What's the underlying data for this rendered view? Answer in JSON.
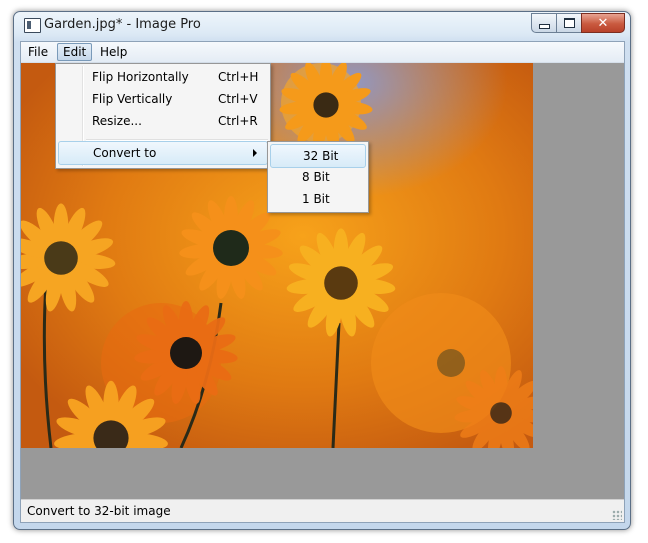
{
  "window": {
    "title": "Garden.jpg* - Image Pro"
  },
  "menubar": {
    "items": [
      "File",
      "Edit",
      "Help"
    ]
  },
  "edit_menu": {
    "items": [
      {
        "label": "Flip Horizontally",
        "shortcut": "Ctrl+H"
      },
      {
        "label": "Flip Vertically",
        "shortcut": "Ctrl+V"
      },
      {
        "label": "Resize...",
        "shortcut": "Ctrl+R"
      },
      {
        "label": "Convert to",
        "shortcut": ""
      }
    ]
  },
  "convert_submenu": {
    "items": [
      "32 Bit",
      "8 Bit",
      "1 Bit"
    ]
  },
  "status": {
    "text": "Convert to 32-bit image"
  },
  "colors": {
    "accent": "#c5d7ea",
    "canvas_bg": "#999999",
    "close_button": "#c95a3f"
  },
  "image": {
    "filename": "Garden.jpg",
    "subject": "orange daisies"
  }
}
